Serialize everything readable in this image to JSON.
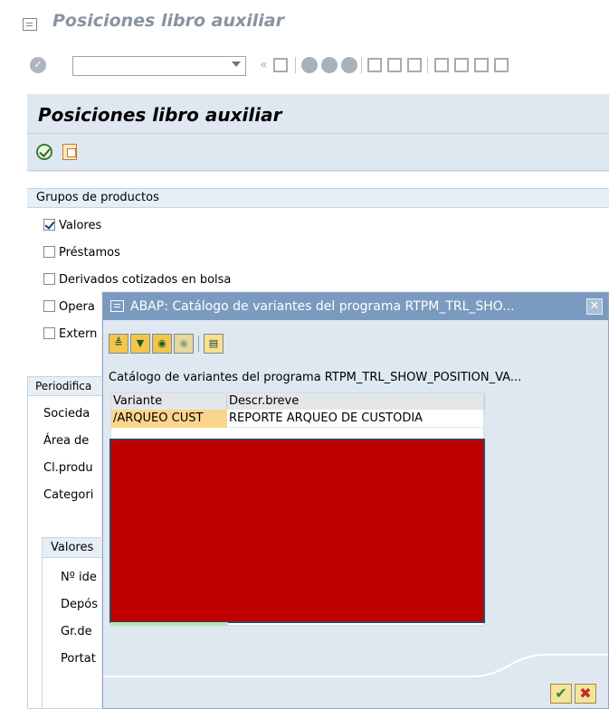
{
  "window": {
    "title": "Posiciones libro auxiliar"
  },
  "toolbar": {
    "command_value": "",
    "nav_back": "«"
  },
  "main": {
    "title": "Posiciones libro auxiliar"
  },
  "product_groups": {
    "header": "Grupos de productos",
    "items": [
      {
        "label": "Valores",
        "checked": true
      },
      {
        "label": "Préstamos",
        "checked": false
      },
      {
        "label": "Derivados cotizados en bolsa",
        "checked": false
      },
      {
        "label": "Opera",
        "checked": false
      },
      {
        "label": "Extern",
        "checked": false
      }
    ]
  },
  "periodification": {
    "header": "Periodifica",
    "fields": [
      "Socieda",
      "Área de",
      "Cl.produ",
      "Categori"
    ]
  },
  "values_block": {
    "header": "Valores",
    "fields": [
      "Nº ide",
      "Depós",
      "Gr.de",
      "Portat"
    ]
  },
  "dialog": {
    "title": "ABAP: Catálogo de variantes del programa RTPM_TRL_SHO...",
    "close": "✕",
    "label": "Catálogo de variantes del programa RTPM_TRL_SHOW_POSITION_VA...",
    "columns": [
      "Variante",
      "Descr.breve"
    ],
    "rows": [
      {
        "variant": "/ARQUEO CUST",
        "description": "REPORTE ARQUEO DE CUSTODIA"
      }
    ],
    "ok": "✔",
    "cancel": "✖"
  }
}
